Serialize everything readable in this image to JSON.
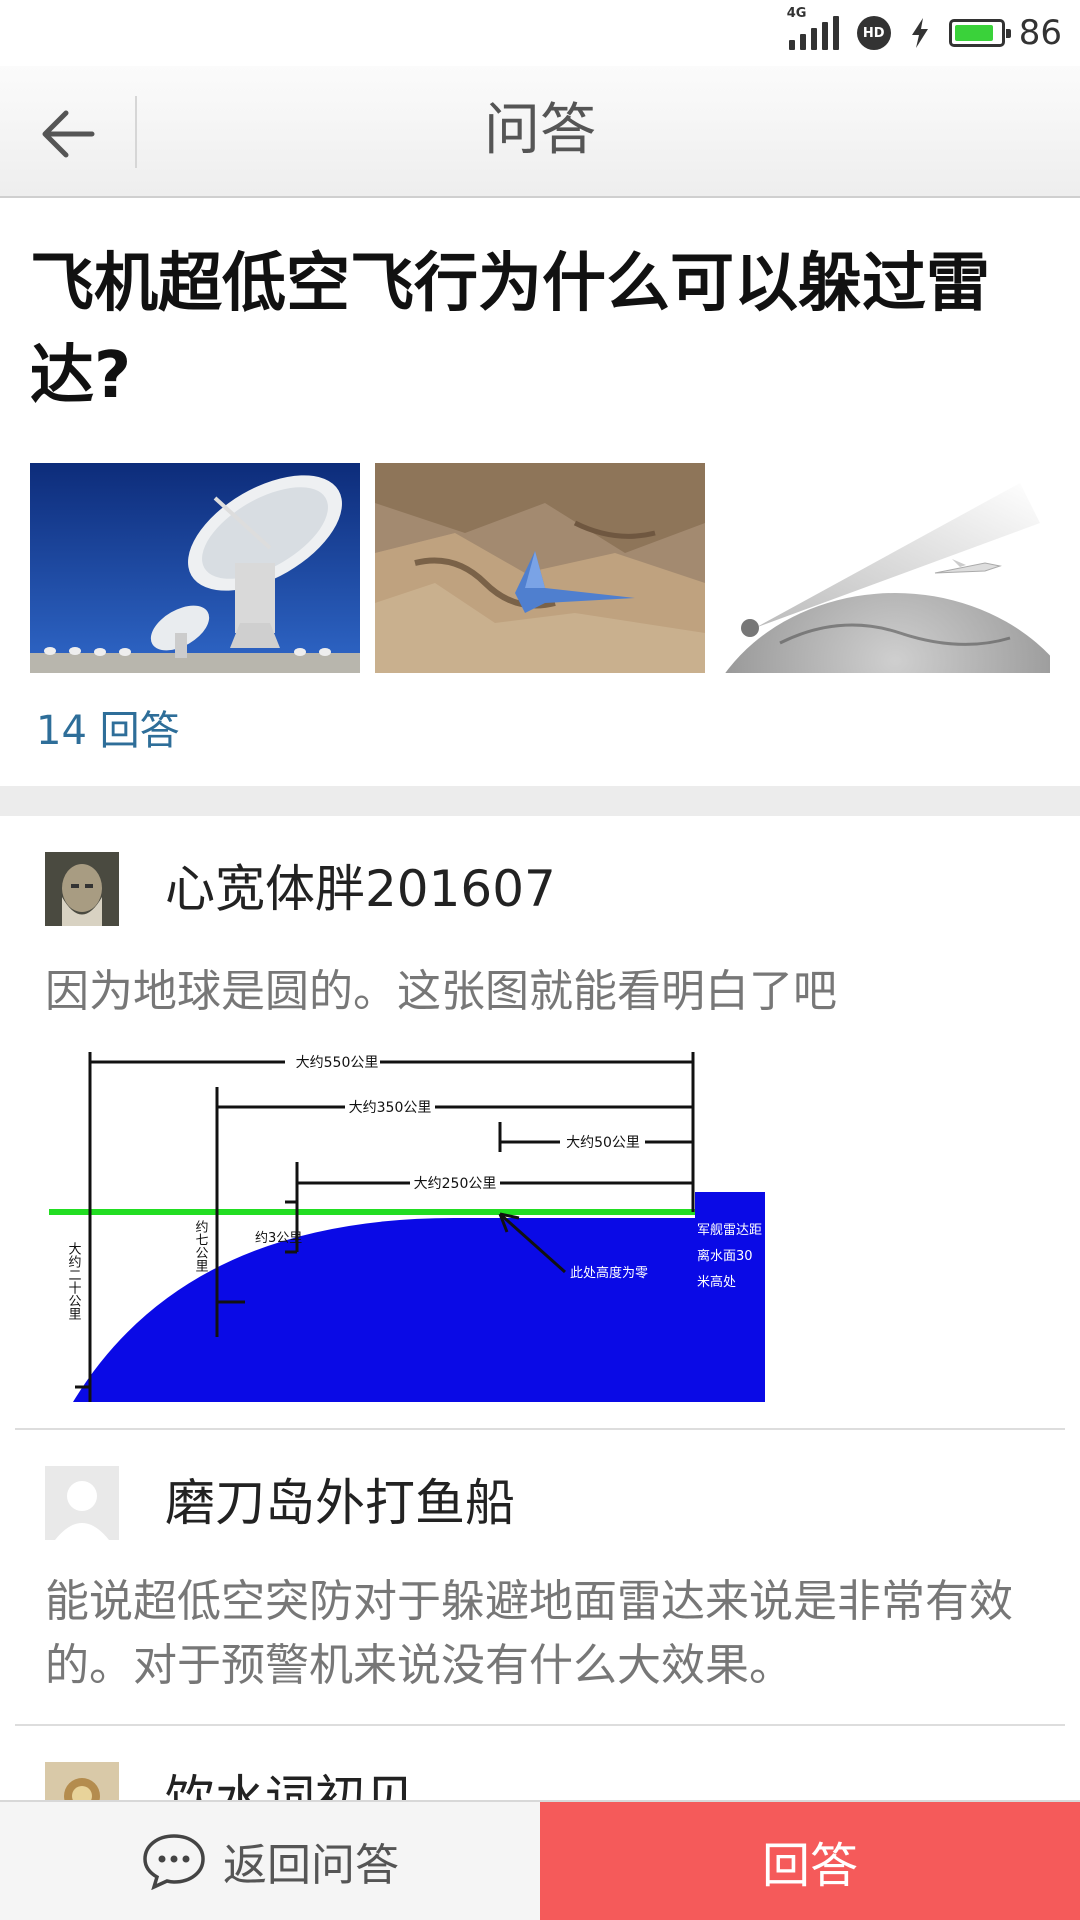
{
  "status_bar": {
    "network": "4G",
    "hd_label": "HD",
    "battery_level": 86,
    "battery_text": "86",
    "battery_color": "#3ad23a"
  },
  "header": {
    "title": "问答",
    "back_icon": "arrow-left-icon"
  },
  "question": {
    "title": "飞机超低空飞行为什么可以躲过雷达?",
    "images": [
      "radar-dish-photo",
      "jet-over-mountains-photo",
      "radar-beam-earth-illustration"
    ],
    "answer_count_text": "14 回答",
    "accent_color": "#2e6e99"
  },
  "answers": [
    {
      "username": "心宽体胖201607",
      "text": "因为地球是圆的。这张图就能看明白了吧",
      "diagram": {
        "labels": {
          "d550": "大约550公里",
          "d350": "大约350公里",
          "d50": "大约50公里",
          "d250": "大约250公里",
          "h3": "约3公里",
          "h7": "约七公里",
          "h20": "大约二十公里",
          "zero": "此处高度为零",
          "ship": "军舰雷达距离水面30米高处"
        },
        "colors": {
          "earth": "#0a0ae6",
          "horizon": "#22dd22"
        }
      }
    },
    {
      "username": "磨刀岛外打鱼船",
      "text": "能说超低空突防对于躲避地面雷达来说是非常有效的。对于预警机来说没有什么大效果。"
    },
    {
      "username": "饮水词初见"
    }
  ],
  "bottom_bar": {
    "back_label": "返回问答",
    "back_icon": "chat-bubble-icon",
    "answer_label": "回答",
    "answer_color": "#f55a5a"
  }
}
